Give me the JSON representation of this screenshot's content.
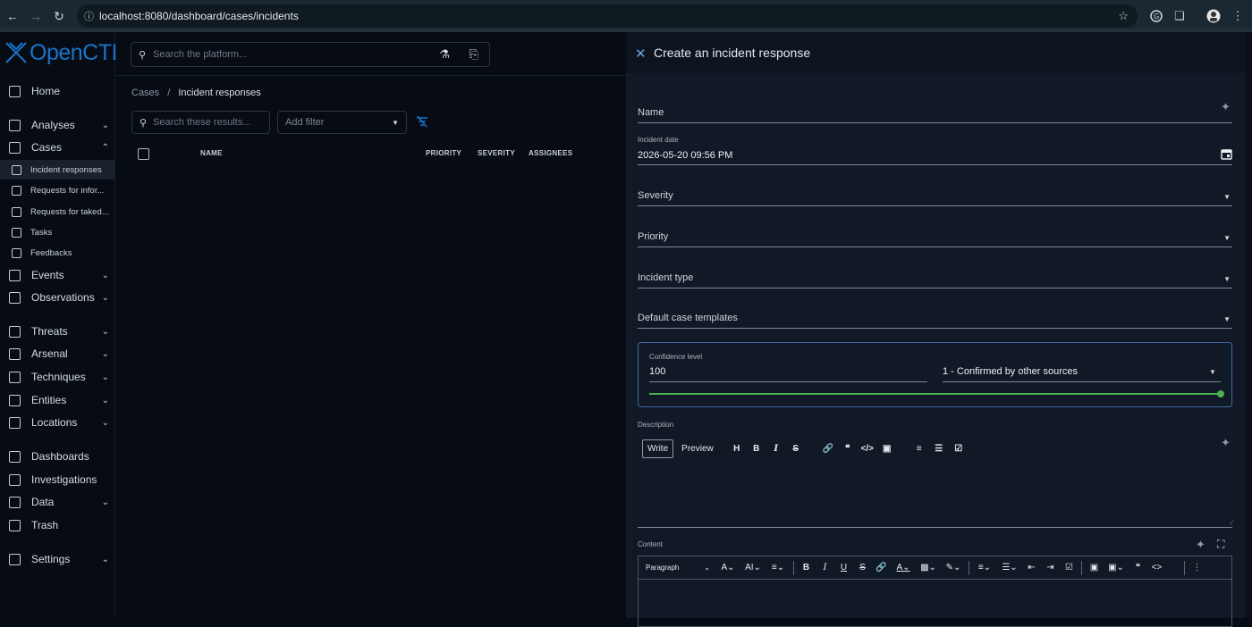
{
  "browser": {
    "url": "localhost:8080/dashboard/cases/incidents"
  },
  "brand": {
    "name": "OpenCTI",
    "color": "#1a73c9"
  },
  "header": {
    "search_placeholder": "Search the platform..."
  },
  "nav": {
    "items": [
      {
        "label": "Home",
        "icon": "home-icon",
        "chevron": ""
      },
      {
        "label": "Analyses",
        "icon": "analyses-icon",
        "chevron": "down"
      },
      {
        "label": "Cases",
        "icon": "cases-icon",
        "chevron": "up"
      },
      {
        "label": "Incident responses",
        "icon": "incident-icon",
        "sub": true,
        "active": true
      },
      {
        "label": "Requests for infor...",
        "icon": "rfi-icon",
        "sub": true
      },
      {
        "label": "Requests for taked...",
        "icon": "rft-icon",
        "sub": true
      },
      {
        "label": "Tasks",
        "icon": "tasks-icon",
        "sub": true
      },
      {
        "label": "Feedbacks",
        "icon": "feedback-icon",
        "sub": true
      },
      {
        "label": "Events",
        "icon": "events-icon",
        "chevron": "down"
      },
      {
        "label": "Observations",
        "icon": "observations-icon",
        "chevron": "down"
      },
      {
        "label": "Threats",
        "icon": "threats-icon",
        "chevron": "down"
      },
      {
        "label": "Arsenal",
        "icon": "arsenal-icon",
        "chevron": "down"
      },
      {
        "label": "Techniques",
        "icon": "techniques-icon",
        "chevron": "down"
      },
      {
        "label": "Entities",
        "icon": "entities-icon",
        "chevron": "down"
      },
      {
        "label": "Locations",
        "icon": "locations-icon",
        "chevron": "down"
      },
      {
        "label": "Dashboards",
        "icon": "dashboards-icon",
        "chevron": ""
      },
      {
        "label": "Investigations",
        "icon": "investigations-icon",
        "chevron": ""
      },
      {
        "label": "Data",
        "icon": "data-icon",
        "chevron": "down"
      },
      {
        "label": "Trash",
        "icon": "trash-icon",
        "chevron": ""
      },
      {
        "label": "Settings",
        "icon": "settings-icon",
        "chevron": "down"
      }
    ]
  },
  "list": {
    "breadcrumb_root": "Cases",
    "breadcrumb_sep": "/",
    "breadcrumb_current": "Incident responses",
    "search_placeholder": "Search these results...",
    "filter_placeholder": "Add filter",
    "columns": {
      "name": "NAME",
      "priority": "PRIORITY",
      "severity": "SEVERITY",
      "assignees": "ASSIGNEES"
    }
  },
  "drawer": {
    "title": "Create an incident response",
    "name_label": "Name",
    "date_label": "Incident date",
    "date_value": "2026-05-20 09:56 PM",
    "severity_label": "Severity",
    "priority_label": "Priority",
    "type_label": "Incident type",
    "templates_label": "Default case templates",
    "confidence_label": "Confidence level",
    "confidence_value": "100",
    "confidence_select": "1 - Confirmed by other sources",
    "confidence_level": 1.0,
    "confidence_color": "#4caf50",
    "description_label": "Description",
    "write_tab": "Write",
    "preview_tab": "Preview",
    "content_label": "Content",
    "paragraph_select": "Paragraph"
  }
}
